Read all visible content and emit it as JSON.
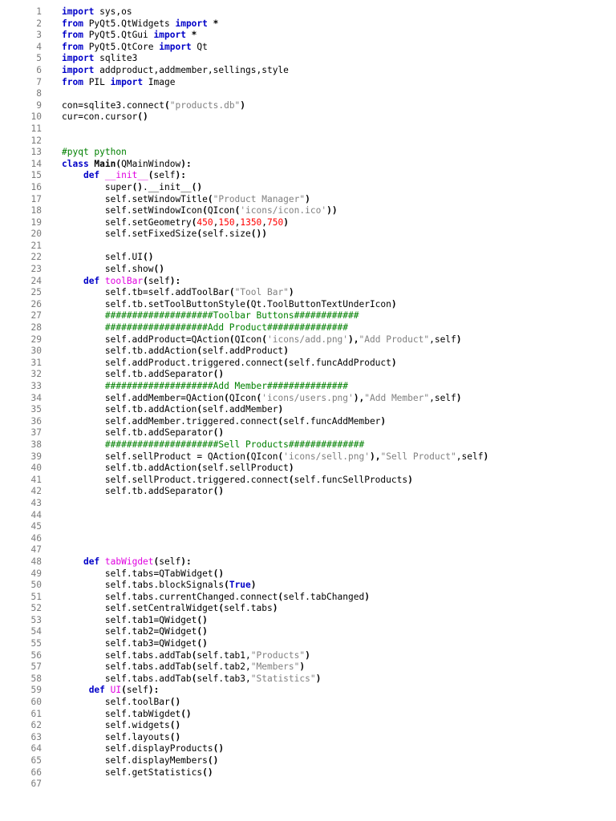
{
  "colors": {
    "keyword": "#0000c8",
    "function_name": "#e000e0",
    "string": "#808080",
    "number": "#ff0000",
    "comment": "#008000",
    "text": "#000000",
    "line_number": "#7a7a7a",
    "background": "#ffffff"
  },
  "lines": [
    {
      "n": "1",
      "tokens": [
        {
          "t": "kw",
          "v": "import"
        },
        {
          "t": "tx",
          "v": " sys,os"
        }
      ]
    },
    {
      "n": "2",
      "tokens": [
        {
          "t": "kw",
          "v": "from"
        },
        {
          "t": "tx",
          "v": " PyQt5.QtWidgets "
        },
        {
          "t": "kw",
          "v": "import"
        },
        {
          "t": "op",
          "v": " *"
        }
      ]
    },
    {
      "n": "3",
      "tokens": [
        {
          "t": "kw",
          "v": "from"
        },
        {
          "t": "tx",
          "v": " PyQt5.QtGui "
        },
        {
          "t": "kw",
          "v": "import"
        },
        {
          "t": "op",
          "v": " *"
        }
      ]
    },
    {
      "n": "4",
      "tokens": [
        {
          "t": "kw",
          "v": "from"
        },
        {
          "t": "tx",
          "v": " PyQt5.QtCore "
        },
        {
          "t": "kw",
          "v": "import"
        },
        {
          "t": "tx",
          "v": " Qt"
        }
      ]
    },
    {
      "n": "5",
      "tokens": [
        {
          "t": "kw",
          "v": "import"
        },
        {
          "t": "tx",
          "v": " sqlite3"
        }
      ]
    },
    {
      "n": "6",
      "tokens": [
        {
          "t": "kw",
          "v": "import"
        },
        {
          "t": "tx",
          "v": " addproduct,addmember,sellings,style"
        }
      ]
    },
    {
      "n": "7",
      "tokens": [
        {
          "t": "kw",
          "v": "from"
        },
        {
          "t": "tx",
          "v": " PIL "
        },
        {
          "t": "kw",
          "v": "import"
        },
        {
          "t": "tx",
          "v": " Image"
        }
      ]
    },
    {
      "n": "8",
      "tokens": []
    },
    {
      "n": "9",
      "tokens": [
        {
          "t": "tx",
          "v": "con=sqlite3.connect"
        },
        {
          "t": "op",
          "v": "("
        },
        {
          "t": "str",
          "v": "\"products.db\""
        },
        {
          "t": "op",
          "v": ")"
        }
      ]
    },
    {
      "n": "10",
      "tokens": [
        {
          "t": "tx",
          "v": "cur=con.cursor"
        },
        {
          "t": "op",
          "v": "()"
        }
      ]
    },
    {
      "n": "11",
      "tokens": []
    },
    {
      "n": "12",
      "tokens": []
    },
    {
      "n": "13",
      "tokens": [
        {
          "t": "cm",
          "v": "#pyqt python"
        }
      ]
    },
    {
      "n": "14",
      "tokens": [
        {
          "t": "kw",
          "v": "class"
        },
        {
          "t": "op",
          "v": " Main("
        },
        {
          "t": "tx",
          "v": "QMainWindow"
        },
        {
          "t": "op",
          "v": "):"
        }
      ]
    },
    {
      "n": "15",
      "tokens": [
        {
          "t": "tx",
          "v": "    "
        },
        {
          "t": "kw",
          "v": "def"
        },
        {
          "t": "fn",
          "v": " __init__"
        },
        {
          "t": "op",
          "v": "("
        },
        {
          "t": "tx",
          "v": "self"
        },
        {
          "t": "op",
          "v": "):"
        }
      ]
    },
    {
      "n": "16",
      "tokens": [
        {
          "t": "tx",
          "v": "        super"
        },
        {
          "t": "op",
          "v": "()"
        },
        {
          "t": "tx",
          "v": ".__init__"
        },
        {
          "t": "op",
          "v": "()"
        }
      ]
    },
    {
      "n": "17",
      "tokens": [
        {
          "t": "tx",
          "v": "        self.setWindowTitle"
        },
        {
          "t": "op",
          "v": "("
        },
        {
          "t": "str",
          "v": "\"Product Manager\""
        },
        {
          "t": "op",
          "v": ")"
        }
      ]
    },
    {
      "n": "18",
      "tokens": [
        {
          "t": "tx",
          "v": "        self.setWindowIcon"
        },
        {
          "t": "op",
          "v": "("
        },
        {
          "t": "tx",
          "v": "QIcon"
        },
        {
          "t": "op",
          "v": "("
        },
        {
          "t": "str",
          "v": "'icons/icon.ico'"
        },
        {
          "t": "op",
          "v": "))"
        }
      ]
    },
    {
      "n": "19",
      "tokens": [
        {
          "t": "tx",
          "v": "        self.setGeometry"
        },
        {
          "t": "op",
          "v": "("
        },
        {
          "t": "num",
          "v": "450"
        },
        {
          "t": "tx",
          "v": ","
        },
        {
          "t": "num",
          "v": "150"
        },
        {
          "t": "tx",
          "v": ","
        },
        {
          "t": "num",
          "v": "1350"
        },
        {
          "t": "tx",
          "v": ","
        },
        {
          "t": "num",
          "v": "750"
        },
        {
          "t": "op",
          "v": ")"
        }
      ]
    },
    {
      "n": "20",
      "tokens": [
        {
          "t": "tx",
          "v": "        self.setFixedSize"
        },
        {
          "t": "op",
          "v": "("
        },
        {
          "t": "tx",
          "v": "self.size"
        },
        {
          "t": "op",
          "v": "())"
        }
      ]
    },
    {
      "n": "21",
      "tokens": []
    },
    {
      "n": "22",
      "tokens": [
        {
          "t": "tx",
          "v": "        self.UI"
        },
        {
          "t": "op",
          "v": "()"
        }
      ]
    },
    {
      "n": "23",
      "tokens": [
        {
          "t": "tx",
          "v": "        self.show"
        },
        {
          "t": "op",
          "v": "()"
        }
      ]
    },
    {
      "n": "24",
      "tokens": [
        {
          "t": "tx",
          "v": "    "
        },
        {
          "t": "kw",
          "v": "def"
        },
        {
          "t": "fn",
          "v": " toolBar"
        },
        {
          "t": "op",
          "v": "("
        },
        {
          "t": "tx",
          "v": "self"
        },
        {
          "t": "op",
          "v": "):"
        }
      ]
    },
    {
      "n": "25",
      "tokens": [
        {
          "t": "tx",
          "v": "        self.tb=self.addToolBar"
        },
        {
          "t": "op",
          "v": "("
        },
        {
          "t": "str",
          "v": "\"Tool Bar\""
        },
        {
          "t": "op",
          "v": ")"
        }
      ]
    },
    {
      "n": "26",
      "tokens": [
        {
          "t": "tx",
          "v": "        self.tb.setToolButtonStyle"
        },
        {
          "t": "op",
          "v": "("
        },
        {
          "t": "tx",
          "v": "Qt.ToolButtonTextUnderIcon"
        },
        {
          "t": "op",
          "v": ")"
        }
      ]
    },
    {
      "n": "27",
      "tokens": [
        {
          "t": "tx",
          "v": "        "
        },
        {
          "t": "cm",
          "v": "####################Toolbar Buttons############"
        }
      ]
    },
    {
      "n": "28",
      "tokens": [
        {
          "t": "tx",
          "v": "        "
        },
        {
          "t": "cm",
          "v": "###################Add Product###############"
        }
      ]
    },
    {
      "n": "29",
      "tokens": [
        {
          "t": "tx",
          "v": "        self.addProduct=QAction"
        },
        {
          "t": "op",
          "v": "("
        },
        {
          "t": "tx",
          "v": "QIcon"
        },
        {
          "t": "op",
          "v": "("
        },
        {
          "t": "str",
          "v": "'icons/add.png'"
        },
        {
          "t": "op",
          "v": "),"
        },
        {
          "t": "str",
          "v": "\"Add Product\""
        },
        {
          "t": "tx",
          "v": ",self"
        },
        {
          "t": "op",
          "v": ")"
        }
      ]
    },
    {
      "n": "30",
      "tokens": [
        {
          "t": "tx",
          "v": "        self.tb.addAction"
        },
        {
          "t": "op",
          "v": "("
        },
        {
          "t": "tx",
          "v": "self.addProduct"
        },
        {
          "t": "op",
          "v": ")"
        }
      ]
    },
    {
      "n": "31",
      "tokens": [
        {
          "t": "tx",
          "v": "        self.addProduct.triggered.connect"
        },
        {
          "t": "op",
          "v": "("
        },
        {
          "t": "tx",
          "v": "self.funcAddProduct"
        },
        {
          "t": "op",
          "v": ")"
        }
      ]
    },
    {
      "n": "32",
      "tokens": [
        {
          "t": "tx",
          "v": "        self.tb.addSeparator"
        },
        {
          "t": "op",
          "v": "()"
        }
      ]
    },
    {
      "n": "33",
      "tokens": [
        {
          "t": "tx",
          "v": "        "
        },
        {
          "t": "cm",
          "v": "####################Add Member###############"
        }
      ]
    },
    {
      "n": "34",
      "tokens": [
        {
          "t": "tx",
          "v": "        self.addMember=QAction"
        },
        {
          "t": "op",
          "v": "("
        },
        {
          "t": "tx",
          "v": "QIcon"
        },
        {
          "t": "op",
          "v": "("
        },
        {
          "t": "str",
          "v": "'icons/users.png'"
        },
        {
          "t": "op",
          "v": "),"
        },
        {
          "t": "str",
          "v": "\"Add Member\""
        },
        {
          "t": "tx",
          "v": ",self"
        },
        {
          "t": "op",
          "v": ")"
        }
      ]
    },
    {
      "n": "35",
      "tokens": [
        {
          "t": "tx",
          "v": "        self.tb.addAction"
        },
        {
          "t": "op",
          "v": "("
        },
        {
          "t": "tx",
          "v": "self.addMember"
        },
        {
          "t": "op",
          "v": ")"
        }
      ]
    },
    {
      "n": "36",
      "tokens": [
        {
          "t": "tx",
          "v": "        self.addMember.triggered.connect"
        },
        {
          "t": "op",
          "v": "("
        },
        {
          "t": "tx",
          "v": "self.funcAddMember"
        },
        {
          "t": "op",
          "v": ")"
        }
      ]
    },
    {
      "n": "37",
      "tokens": [
        {
          "t": "tx",
          "v": "        self.tb.addSeparator"
        },
        {
          "t": "op",
          "v": "()"
        }
      ]
    },
    {
      "n": "38",
      "tokens": [
        {
          "t": "tx",
          "v": "        "
        },
        {
          "t": "cm",
          "v": "#####################Sell Products##############"
        }
      ]
    },
    {
      "n": "39",
      "tokens": [
        {
          "t": "tx",
          "v": "        self.sellProduct = QAction"
        },
        {
          "t": "op",
          "v": "("
        },
        {
          "t": "tx",
          "v": "QIcon"
        },
        {
          "t": "op",
          "v": "("
        },
        {
          "t": "str",
          "v": "'icons/sell.png'"
        },
        {
          "t": "op",
          "v": "),"
        },
        {
          "t": "str",
          "v": "\"Sell Product\""
        },
        {
          "t": "tx",
          "v": ",self"
        },
        {
          "t": "op",
          "v": ")"
        }
      ]
    },
    {
      "n": "40",
      "tokens": [
        {
          "t": "tx",
          "v": "        self.tb.addAction"
        },
        {
          "t": "op",
          "v": "("
        },
        {
          "t": "tx",
          "v": "self.sellProduct"
        },
        {
          "t": "op",
          "v": ")"
        }
      ]
    },
    {
      "n": "41",
      "tokens": [
        {
          "t": "tx",
          "v": "        self.sellProduct.triggered.connect"
        },
        {
          "t": "op",
          "v": "("
        },
        {
          "t": "tx",
          "v": "self.funcSellProducts"
        },
        {
          "t": "op",
          "v": ")"
        }
      ]
    },
    {
      "n": "42",
      "tokens": [
        {
          "t": "tx",
          "v": "        self.tb.addSeparator"
        },
        {
          "t": "op",
          "v": "()"
        }
      ]
    },
    {
      "n": "43",
      "tokens": []
    },
    {
      "n": "44",
      "tokens": []
    },
    {
      "n": "45",
      "tokens": []
    },
    {
      "n": "46",
      "tokens": []
    },
    {
      "n": "47",
      "tokens": []
    },
    {
      "n": "48",
      "tokens": [
        {
          "t": "tx",
          "v": "    "
        },
        {
          "t": "kw",
          "v": "def"
        },
        {
          "t": "fn",
          "v": " tabWigdet"
        },
        {
          "t": "op",
          "v": "("
        },
        {
          "t": "tx",
          "v": "self"
        },
        {
          "t": "op",
          "v": "):"
        }
      ]
    },
    {
      "n": "49",
      "tokens": [
        {
          "t": "tx",
          "v": "        self.tabs=QTabWidget"
        },
        {
          "t": "op",
          "v": "()"
        }
      ]
    },
    {
      "n": "50",
      "tokens": [
        {
          "t": "tx",
          "v": "        self.tabs.blockSignals"
        },
        {
          "t": "op",
          "v": "("
        },
        {
          "t": "kw",
          "v": "True"
        },
        {
          "t": "op",
          "v": ")"
        }
      ]
    },
    {
      "n": "51",
      "tokens": [
        {
          "t": "tx",
          "v": "        self.tabs.currentChanged.connect"
        },
        {
          "t": "op",
          "v": "("
        },
        {
          "t": "tx",
          "v": "self.tabChanged"
        },
        {
          "t": "op",
          "v": ")"
        }
      ]
    },
    {
      "n": "52",
      "tokens": [
        {
          "t": "tx",
          "v": "        self.setCentralWidget"
        },
        {
          "t": "op",
          "v": "("
        },
        {
          "t": "tx",
          "v": "self.tabs"
        },
        {
          "t": "op",
          "v": ")"
        }
      ]
    },
    {
      "n": "53",
      "tokens": [
        {
          "t": "tx",
          "v": "        self.tab1=QWidget"
        },
        {
          "t": "op",
          "v": "()"
        }
      ]
    },
    {
      "n": "54",
      "tokens": [
        {
          "t": "tx",
          "v": "        self.tab2=QWidget"
        },
        {
          "t": "op",
          "v": "()"
        }
      ]
    },
    {
      "n": "55",
      "tokens": [
        {
          "t": "tx",
          "v": "        self.tab3=QWidget"
        },
        {
          "t": "op",
          "v": "()"
        }
      ]
    },
    {
      "n": "56",
      "tokens": [
        {
          "t": "tx",
          "v": "        self.tabs.addTab"
        },
        {
          "t": "op",
          "v": "("
        },
        {
          "t": "tx",
          "v": "self.tab1,"
        },
        {
          "t": "str",
          "v": "\"Products\""
        },
        {
          "t": "op",
          "v": ")"
        }
      ]
    },
    {
      "n": "57",
      "tokens": [
        {
          "t": "tx",
          "v": "        self.tabs.addTab"
        },
        {
          "t": "op",
          "v": "("
        },
        {
          "t": "tx",
          "v": "self.tab2,"
        },
        {
          "t": "str",
          "v": "\"Members\""
        },
        {
          "t": "op",
          "v": ")"
        }
      ]
    },
    {
      "n": "58",
      "tokens": [
        {
          "t": "tx",
          "v": "        self.tabs.addTab"
        },
        {
          "t": "op",
          "v": "("
        },
        {
          "t": "tx",
          "v": "self.tab3,"
        },
        {
          "t": "str",
          "v": "\"Statistics\""
        },
        {
          "t": "op",
          "v": ")"
        }
      ]
    },
    {
      "n": "59",
      "tokens": [
        {
          "t": "tx",
          "v": "     "
        },
        {
          "t": "kw",
          "v": "def"
        },
        {
          "t": "fn",
          "v": " UI"
        },
        {
          "t": "op",
          "v": "("
        },
        {
          "t": "tx",
          "v": "self"
        },
        {
          "t": "op",
          "v": "):"
        }
      ]
    },
    {
      "n": "60",
      "tokens": [
        {
          "t": "tx",
          "v": "        self.toolBar"
        },
        {
          "t": "op",
          "v": "()"
        }
      ]
    },
    {
      "n": "61",
      "tokens": [
        {
          "t": "tx",
          "v": "        self.tabWigdet"
        },
        {
          "t": "op",
          "v": "()"
        }
      ]
    },
    {
      "n": "62",
      "tokens": [
        {
          "t": "tx",
          "v": "        self.widgets"
        },
        {
          "t": "op",
          "v": "()"
        }
      ]
    },
    {
      "n": "63",
      "tokens": [
        {
          "t": "tx",
          "v": "        self.layouts"
        },
        {
          "t": "op",
          "v": "()"
        }
      ]
    },
    {
      "n": "64",
      "tokens": [
        {
          "t": "tx",
          "v": "        self.displayProducts"
        },
        {
          "t": "op",
          "v": "()"
        }
      ]
    },
    {
      "n": "65",
      "tokens": [
        {
          "t": "tx",
          "v": "        self.displayMembers"
        },
        {
          "t": "op",
          "v": "()"
        }
      ]
    },
    {
      "n": "66",
      "tokens": [
        {
          "t": "tx",
          "v": "        self.getStatistics"
        },
        {
          "t": "op",
          "v": "()"
        }
      ]
    },
    {
      "n": "67",
      "tokens": []
    }
  ]
}
